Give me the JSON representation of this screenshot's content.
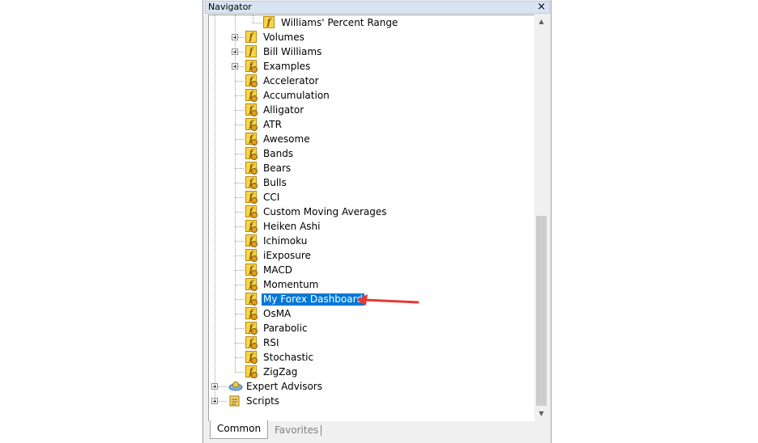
{
  "window": {
    "title": "Navigator",
    "close_glyph": "×"
  },
  "tree": {
    "items": [
      {
        "label": "Williams' Percent Range",
        "icon": "indicator-icon",
        "level": 2
      },
      {
        "label": "Volumes",
        "icon": "indicator-folder-icon",
        "level": 1,
        "expandable": true
      },
      {
        "label": "Bill Williams",
        "icon": "indicator-folder-icon",
        "level": 1,
        "expandable": true
      },
      {
        "label": "Examples",
        "icon": "custom-indicator-icon",
        "level": 1,
        "expandable": true
      },
      {
        "label": "Accelerator",
        "icon": "custom-indicator-icon",
        "level": 1
      },
      {
        "label": "Accumulation",
        "icon": "custom-indicator-icon",
        "level": 1
      },
      {
        "label": "Alligator",
        "icon": "custom-indicator-icon",
        "level": 1
      },
      {
        "label": "ATR",
        "icon": "custom-indicator-icon",
        "level": 1
      },
      {
        "label": "Awesome",
        "icon": "custom-indicator-icon",
        "level": 1
      },
      {
        "label": "Bands",
        "icon": "custom-indicator-icon",
        "level": 1
      },
      {
        "label": "Bears",
        "icon": "custom-indicator-icon",
        "level": 1
      },
      {
        "label": "Bulls",
        "icon": "custom-indicator-icon",
        "level": 1
      },
      {
        "label": "CCI",
        "icon": "custom-indicator-icon",
        "level": 1
      },
      {
        "label": "Custom Moving Averages",
        "icon": "custom-indicator-icon",
        "level": 1
      },
      {
        "label": "Heiken Ashi",
        "icon": "custom-indicator-icon",
        "level": 1
      },
      {
        "label": "Ichimoku",
        "icon": "custom-indicator-icon",
        "level": 1
      },
      {
        "label": "iExposure",
        "icon": "custom-indicator-icon",
        "level": 1
      },
      {
        "label": "MACD",
        "icon": "custom-indicator-icon",
        "level": 1
      },
      {
        "label": "Momentum",
        "icon": "custom-indicator-icon",
        "level": 1
      },
      {
        "label": "My Forex Dashboard",
        "icon": "custom-indicator-icon",
        "level": 1,
        "selected": true
      },
      {
        "label": "OsMA",
        "icon": "custom-indicator-icon",
        "level": 1
      },
      {
        "label": "Parabolic",
        "icon": "custom-indicator-icon",
        "level": 1
      },
      {
        "label": "RSI",
        "icon": "custom-indicator-icon",
        "level": 1
      },
      {
        "label": "Stochastic",
        "icon": "custom-indicator-icon",
        "level": 1
      },
      {
        "label": "ZigZag",
        "icon": "custom-indicator-icon",
        "level": 1
      },
      {
        "label": "Expert Advisors",
        "icon": "expert-advisors-icon",
        "level": 0,
        "expandable": true
      },
      {
        "label": "Scripts",
        "icon": "scripts-icon",
        "level": 0,
        "expandable": true
      }
    ]
  },
  "tabs": [
    {
      "label": "Common",
      "active": true
    },
    {
      "label": "Favorites",
      "active": false
    }
  ],
  "colors": {
    "selection": "#0078d7",
    "annotation_arrow": "#e53935",
    "indicator_icon": "#f7d64a"
  }
}
